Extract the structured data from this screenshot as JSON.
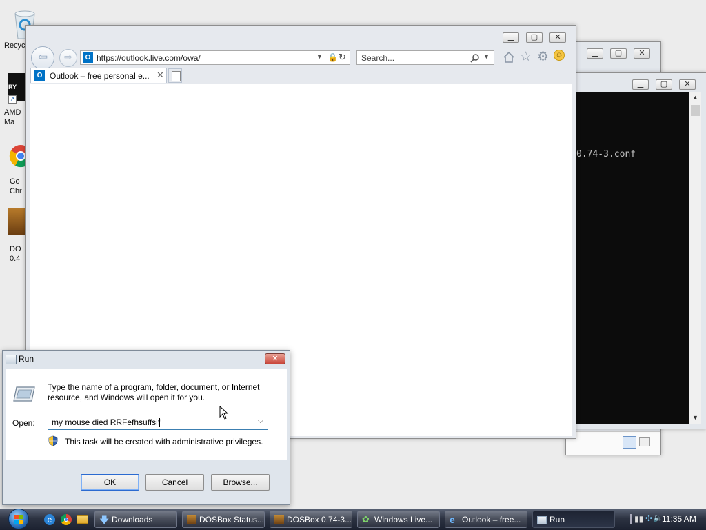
{
  "desktop": {
    "icons": [
      {
        "label": "Recyc"
      },
      {
        "label": "AMD\nMa"
      },
      {
        "label": "Go\nChr"
      },
      {
        "label": "DO\n0.4"
      }
    ]
  },
  "dosbox": {
    "console_text": "0.74-3.conf"
  },
  "ie": {
    "address": "https://outlook.live.com/owa/",
    "search_placeholder": "Search...",
    "tab_title": "Outlook – free personal e..."
  },
  "run": {
    "title": "Run",
    "description": "Type the name of a program, folder, document, or Internet resource, and Windows will open it for you.",
    "open_label": "Open:",
    "open_value": "my mouse died RRFefhsuffsif",
    "admin_note": "This task will be created with administrative privileges.",
    "ok_label": "OK",
    "cancel_label": "Cancel",
    "browse_label": "Browse..."
  },
  "taskbar": {
    "items": [
      {
        "label": "Downloads"
      },
      {
        "label": "DOSBox Status..."
      },
      {
        "label": "DOSBox 0.74-3..."
      },
      {
        "label": "Windows Live..."
      },
      {
        "label": "Outlook – free..."
      },
      {
        "label": "Run"
      }
    ],
    "clock": "11:35 AM"
  }
}
